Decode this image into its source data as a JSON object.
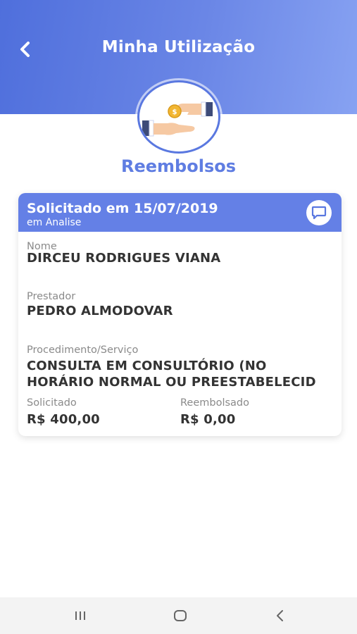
{
  "header": {
    "title": "Minha Utilização",
    "back_icon": "chevron-left-icon",
    "gradient": [
      "#4f6fdc",
      "#87a2f2"
    ]
  },
  "hero": {
    "icon": "hand-coin-refund-icon",
    "section_title": "Reembolsos",
    "accent": "#5f7de2"
  },
  "card": {
    "header_color": "#6480e6",
    "date_text": "Solicitado em 15/07/2019",
    "status": "em Analise",
    "chat_icon": "chat-bubble-icon",
    "fields": {
      "nome_label": "Nome",
      "nome_value": "DIRCEU RODRIGUES VIANA",
      "prestador_label": "Prestador",
      "prestador_value": "PEDRO ALMODOVAR",
      "procedimento_label": "Procedimento/Serviço",
      "procedimento_line1": "CONSULTA EM CONSULTÓRIO (NO",
      "procedimento_line2": "HORÁRIO NORMAL OU PREESTABELECID",
      "solicitado_label": "Solicitado",
      "solicitado_value": "R$ 400,00",
      "reembolsado_label": "Reembolsado",
      "reembolsado_value": "R$ 0,00"
    }
  },
  "navbar": {
    "recents_icon": "recent-apps-icon",
    "home_icon": "home-icon",
    "back_icon": "back-icon"
  }
}
